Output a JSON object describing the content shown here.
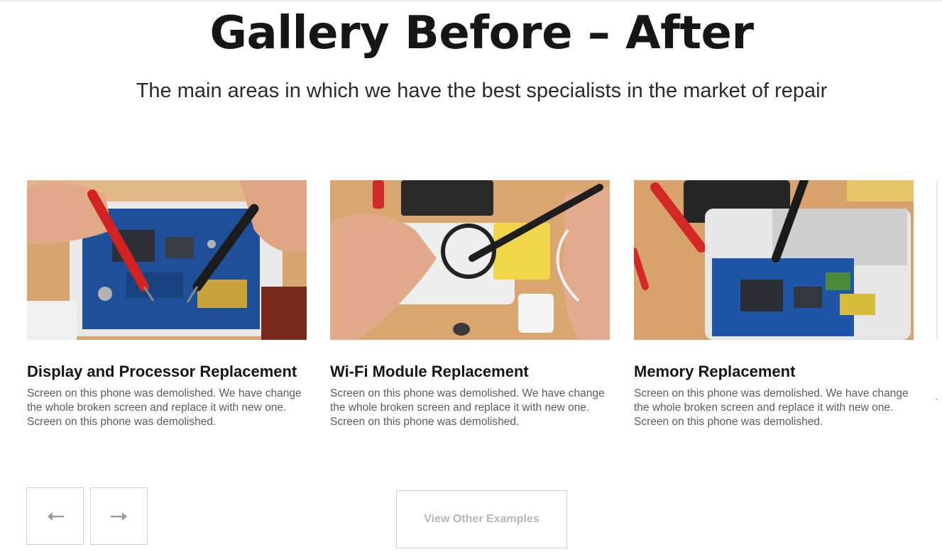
{
  "section": {
    "title": "Gallery Before – After",
    "subtitle": "The main areas in which we have the best specialists in the market of repair"
  },
  "cards": [
    {
      "title": "Display and Processor Replacement",
      "text": "Screen on this phone was demolished. We have change the whole broken screen and replace it with new one. Screen on this phone was demolished.",
      "image_alt": "Hands testing a circuit board with red and black multimeter probes"
    },
    {
      "title": "Wi-Fi Module Replacement",
      "text": "Screen on this phone was demolished. We have change the whole broken screen and replace it with new one. Screen on this phone was demolished.",
      "image_alt": "Hands soldering a phone component under a magnifying glass"
    },
    {
      "title": "Memory Replacement",
      "text": "Screen on this phone was demolished. We have change the whole broken screen and replace it with new one. Screen on this phone was demolished.",
      "image_alt": "Disassembled tablet on a wooden desk with a soldering iron and screwdrivers"
    }
  ],
  "controls": {
    "prev_icon": "arrow-left-icon",
    "next_icon": "arrow-right-icon",
    "view_other_label": "View Other Examples"
  },
  "colors": {
    "title": "#161616",
    "body_text": "#5c5c5c",
    "border": "#cfcfcf",
    "button_text": "#b5b5b5",
    "wood": "#d9a36e",
    "board_blue": "#1d4f9a"
  }
}
